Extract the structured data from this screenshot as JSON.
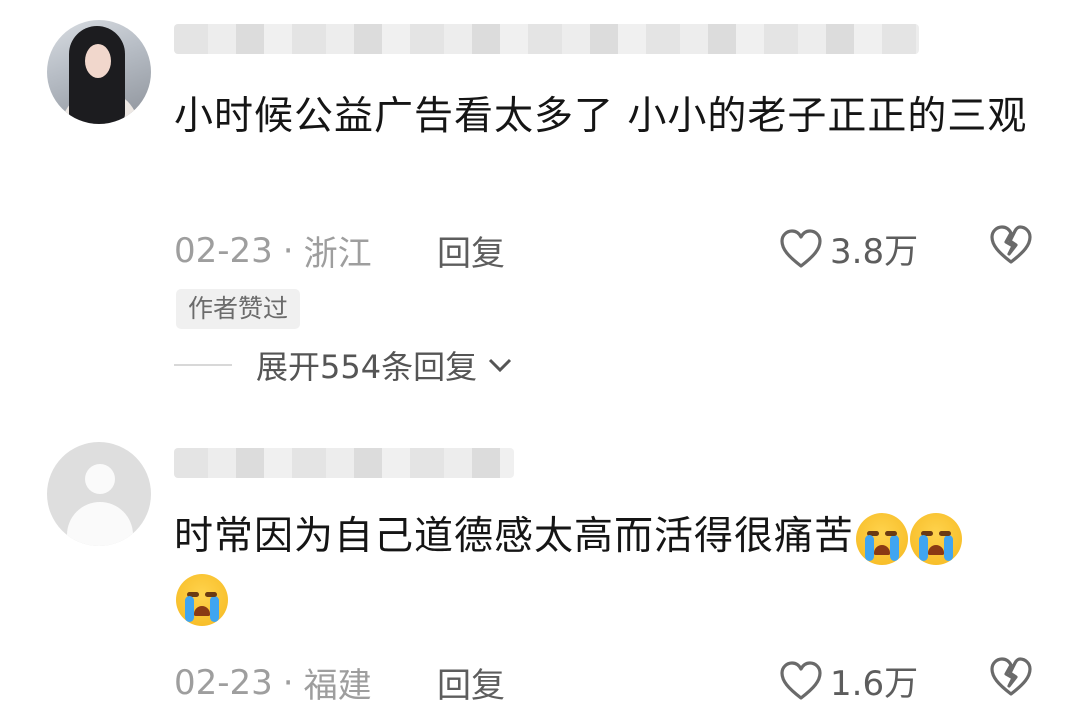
{
  "comments": [
    {
      "text": "小时候公益广告看太多了 小小的老子正正的三观",
      "date": "02-23",
      "location": "浙江",
      "reply_label": "回复",
      "likes": "3.8万",
      "badge": "作者赞过",
      "expand_label": "展开554条回复"
    },
    {
      "text": "时常因为自己道德感太高而活得很痛苦",
      "date": "02-23",
      "location": "福建",
      "reply_label": "回复",
      "likes": "1.6万"
    }
  ],
  "icons": {
    "like": "heart-outline-icon",
    "dislike": "broken-heart-icon",
    "expand": "chevron-down-icon",
    "emoji": "loudly-crying-face-emoji"
  }
}
